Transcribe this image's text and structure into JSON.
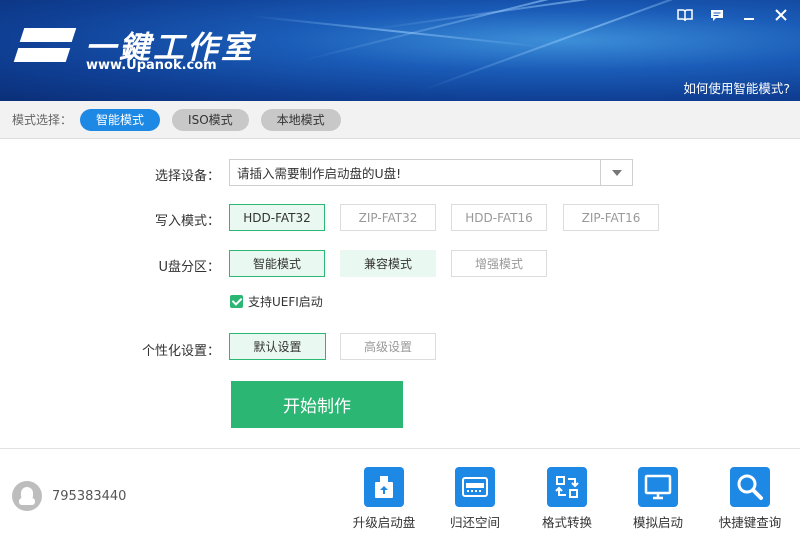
{
  "header": {
    "title": "一鍵工作室",
    "url": "www.Upanok.com",
    "help_link": "如何使用智能模式?"
  },
  "mode_bar": {
    "label": "模式选择：",
    "modes": [
      {
        "label": "智能模式",
        "active": true
      },
      {
        "label": "ISO模式",
        "active": false
      },
      {
        "label": "本地模式",
        "active": false
      }
    ]
  },
  "form": {
    "device": {
      "label": "选择设备：",
      "value": "请插入需要制作启动盘的U盘!"
    },
    "write_mode": {
      "label": "写入模式：",
      "options": [
        "HDD-FAT32",
        "ZIP-FAT32",
        "HDD-FAT16",
        "ZIP-FAT16"
      ],
      "selected": "HDD-FAT32"
    },
    "partition": {
      "label": "U盘分区：",
      "options": [
        "智能模式",
        "兼容模式",
        "增强模式"
      ],
      "selected": "智能模式"
    },
    "uefi": {
      "label": "支持UEFI启动",
      "checked": true
    },
    "personalize": {
      "label": "个性化设置：",
      "options": [
        "默认设置",
        "高级设置"
      ],
      "selected": "默认设置"
    },
    "start_button": "开始制作"
  },
  "footer": {
    "qq_number": "795383440",
    "tools": [
      {
        "label": "升级启动盘",
        "icon": "upgrade-icon"
      },
      {
        "label": "归还空间",
        "icon": "restore-space-icon"
      },
      {
        "label": "格式转换",
        "icon": "format-convert-icon"
      },
      {
        "label": "模拟启动",
        "icon": "simulate-boot-icon"
      },
      {
        "label": "快捷键查询",
        "icon": "shortcut-search-icon"
      }
    ]
  },
  "colors": {
    "accent_blue": "#1e88e5",
    "accent_green": "#2bb673",
    "header_dark": "#0f3f94"
  }
}
